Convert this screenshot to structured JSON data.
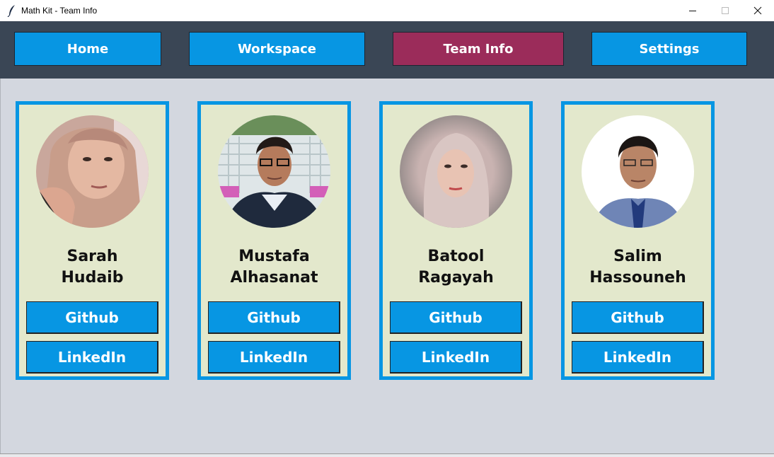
{
  "window": {
    "title": "Math Kit - Team Info",
    "icon": "feather-icon",
    "controls": [
      "minimize-icon",
      "maximize-icon",
      "close-icon"
    ]
  },
  "nav": {
    "items": [
      {
        "label": "Home",
        "active": false
      },
      {
        "label": "Workspace",
        "active": false
      },
      {
        "label": "Team Info",
        "active": true
      },
      {
        "label": "Settings",
        "active": false
      }
    ]
  },
  "team": [
    {
      "first": "Sarah",
      "last": "Hudaib",
      "github": "Github",
      "linkedin": "LinkedIn"
    },
    {
      "first": "Mustafa",
      "last": "Alhasanat",
      "github": "Github",
      "linkedin": "LinkedIn"
    },
    {
      "first": "Batool",
      "last": "Ragayah",
      "github": "Github",
      "linkedin": "LinkedIn"
    },
    {
      "first": "Salim",
      "last": "Hassouneh",
      "github": "Github",
      "linkedin": "LinkedIn"
    }
  ],
  "colors": {
    "nav_bg": "#3a4655",
    "button": "#0796e3",
    "active": "#9b2c5a",
    "card_bg": "#e3e8cc",
    "content_bg": "#d3d7df"
  }
}
